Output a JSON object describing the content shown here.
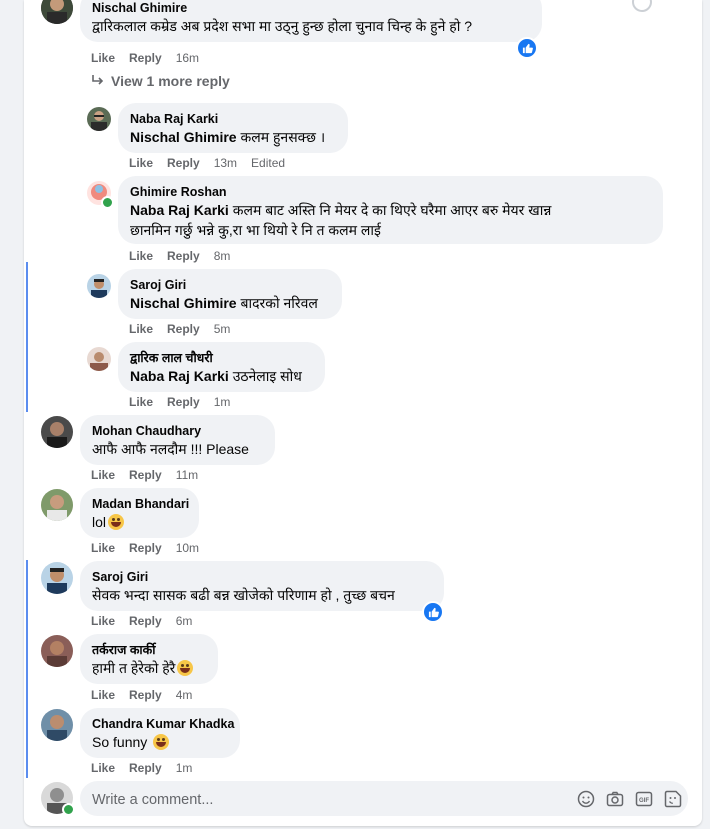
{
  "comments": [
    {
      "author": "Nischal Ghimire",
      "text": "द्वारिकलाल कम्रेड अब प्रदेश सभा मा उठ्नु हुन्छ होला चुनाव चिन्ह के हुने हो ?",
      "like": "Like",
      "reply": "Reply",
      "time": "16m"
    },
    {
      "author": "Naba Raj Karki",
      "mention": "Nischal Ghimire",
      "text": " कलम हुनसक्छ ।",
      "like": "Like",
      "reply": "Reply",
      "time": "13m",
      "edited": "Edited"
    },
    {
      "author": "Ghimire Roshan",
      "mention": "Naba Raj Karki",
      "text_line1": " कलम बाट अस्ति नि मेयर दे का थिएरे घरैमा आएर बरु मेयर खान्न",
      "text_line2": "छानमिन गर्छु भन्ने कु,रा भा थियो रे नि त कलम लाई",
      "like": "Like",
      "reply": "Reply",
      "time": "8m"
    },
    {
      "author": "Saroj Giri",
      "mention": "Nischal Ghimire",
      "text": " बादरको नरिवल",
      "like": "Like",
      "reply": "Reply",
      "time": "5m"
    },
    {
      "author": "द्वारिक लाल चौधरी",
      "mention": "Naba Raj Karki",
      "text": " उठनेलाइ सोध",
      "like": "Like",
      "reply": "Reply",
      "time": "1m"
    },
    {
      "author": "Mohan Chaudhary",
      "text": "आफै आफै नलदौम !!! Please",
      "like": "Like",
      "reply": "Reply",
      "time": "11m"
    },
    {
      "author": "Madan Bhandari",
      "text": "lol",
      "like": "Like",
      "reply": "Reply",
      "time": "10m"
    },
    {
      "author": "Saroj Giri",
      "text": "सेवक भन्दा सासक बढी बन्न खोजेको परिणाम हो , तुच्छ बचन",
      "like": "Like",
      "reply": "Reply",
      "time": "6m"
    },
    {
      "author": "तर्कराज कार्की",
      "text": "हामी त हेरेको हेरै",
      "like": "Like",
      "reply": "Reply",
      "time": "4m"
    },
    {
      "author": "Chandra Kumar Khadka",
      "text": "So funny",
      "like": "Like",
      "reply": "Reply",
      "time": "1m"
    }
  ],
  "view_more": "View 1 more reply",
  "composer": {
    "placeholder": "Write a comment..."
  },
  "icons": [
    "thumbs-up-reaction-icon",
    "reply-arrow-icon",
    "emoji-icon",
    "camera-icon",
    "gif-icon",
    "sticker-icon",
    "grinning-emoji-icon"
  ],
  "colors": {
    "accent": "#1877f2",
    "thread": "#5b8def",
    "bubble": "#f0f2f5",
    "meta": "#65676b",
    "online": "#31a24c"
  }
}
